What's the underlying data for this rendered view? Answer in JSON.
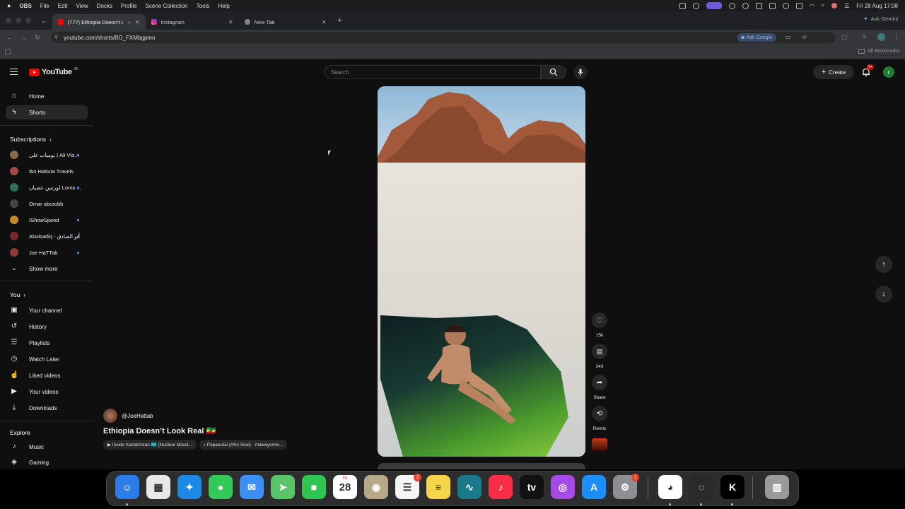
{
  "menubar": {
    "app": "OBS",
    "items": [
      "File",
      "Edit",
      "View",
      "Docks",
      "Profile",
      "Scene Collection",
      "Tools",
      "Help"
    ],
    "datetime": "Fri 28 Aug  17:08"
  },
  "browser": {
    "tabs": [
      {
        "label": "(777) Ethiopia Doesn't Lo…",
        "active": true
      },
      {
        "label": "Instagram",
        "active": false
      },
      {
        "label": "New Tab",
        "active": false
      }
    ],
    "ask_gemini": "Ask Gemini",
    "url": "youtube.com/shorts/BO_FXMbgpmo",
    "ask_google": "Ask Google",
    "all_bookmarks": "All Bookmarks"
  },
  "youtube": {
    "logo_text": "YouTube",
    "logo_region": "AE",
    "search_placeholder": "Search",
    "create_label": "Create",
    "notif_badge": "9+",
    "avatar_letter": "r",
    "sidebar": {
      "home": "Home",
      "shorts": "Shorts",
      "subscriptions_title": "Subscriptions",
      "subscriptions": [
        {
          "name": "يوميات علي | Ali Vlo...",
          "live": true,
          "color": "#8a6a4a"
        },
        {
          "name": "Ibn Hattuta Travels",
          "live": false,
          "color": "#a04a4a"
        },
        {
          "name": "لورنس عصيان Lorns ...",
          "live": true,
          "color": "#2f6f5f"
        },
        {
          "name": "Omar aburobb",
          "live": false,
          "color": "#444444"
        },
        {
          "name": "IShowSpeed",
          "live": true,
          "color": "#c7892b"
        },
        {
          "name": "Abulsadiq - أبو الصادق",
          "live": true,
          "color": "#7a2a2a"
        },
        {
          "name": "Joe HaTTab",
          "live": true,
          "color": "#8a3a3a"
        }
      ],
      "show_more": "Show more",
      "you_title": "You",
      "you_items": [
        "Your channel",
        "History",
        "Playlists",
        "Watch Later",
        "Liked videos",
        "Your videos",
        "Downloads"
      ],
      "explore_title": "Explore",
      "explore_items": [
        "Music",
        "Gaming"
      ]
    },
    "short": {
      "channel": "@JoeHattab",
      "title": "Ethiopia Doesn’t Look Real 🇪🇹",
      "chips": [
        "▶ Inside Kazakhstan 🇰🇿 (Nuclear Missil...",
        "♪ Papaoutai (Afro Soul) · mikeeysmin..."
      ],
      "likes": "15k",
      "comments": "243",
      "share": "Share",
      "remix": "Remix"
    }
  },
  "dock": {
    "apps": [
      {
        "name": "Finder",
        "color": "#2b7de9",
        "glyph": "☺"
      },
      {
        "name": "Launchpad",
        "color": "#e8e8e8",
        "glyph": "▦"
      },
      {
        "name": "Safari",
        "color": "#1e88e5",
        "glyph": "✦"
      },
      {
        "name": "Messages",
        "color": "#34c759",
        "glyph": "●"
      },
      {
        "name": "Mail",
        "color": "#3d8ef5",
        "glyph": "✉"
      },
      {
        "name": "Maps",
        "color": "#5ac469",
        "glyph": "➤"
      },
      {
        "name": "FaceTime",
        "color": "#30c453",
        "glyph": "■"
      },
      {
        "name": "Calendar",
        "color": "#ffffff",
        "glyph": "28"
      },
      {
        "name": "Contacts",
        "color": "#b8a88a",
        "glyph": "◉"
      },
      {
        "name": "Reminders",
        "color": "#f5f5f5",
        "glyph": "☰"
      },
      {
        "name": "Notes",
        "color": "#f7d54a",
        "glyph": "≡"
      },
      {
        "name": "Freeform",
        "color": "#1a7a8a",
        "glyph": "∿"
      },
      {
        "name": "Music",
        "color": "#fa2d48",
        "glyph": "♪"
      },
      {
        "name": "TV",
        "color": "#111111",
        "glyph": "tv"
      },
      {
        "name": "Podcasts",
        "color": "#a64ae8",
        "glyph": "◎"
      },
      {
        "name": "App Store",
        "color": "#1c8ef9",
        "glyph": "A"
      },
      {
        "name": "System Settings",
        "color": "#8e8e93",
        "glyph": "⚙"
      },
      {
        "name": "Chrome",
        "color": "#ffffff",
        "glyph": "◕"
      },
      {
        "name": "OBS",
        "color": "#2a2a2a",
        "glyph": "◌"
      },
      {
        "name": "Kick",
        "color": "#000000",
        "glyph": "K"
      },
      {
        "name": "Trash",
        "color": "#9a9a9a",
        "glyph": "▥"
      }
    ],
    "calendar_day_label": "Fri",
    "reminders_badge": "2",
    "settings_badge": "1"
  }
}
